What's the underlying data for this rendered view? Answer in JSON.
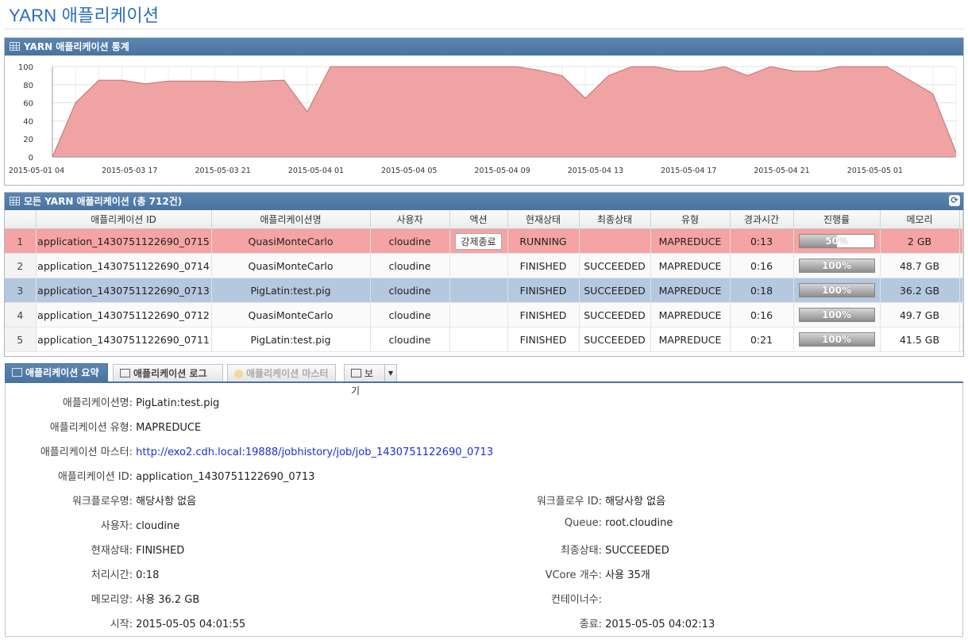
{
  "page": {
    "title": "YARN 애플리케이션"
  },
  "colors": {
    "header": "#4a73a0",
    "area_fill": "#f0a3a3",
    "area_line": "#c07070",
    "running_row": "#f5a3a3",
    "selected_row": "#b4c8df",
    "link": "#1a2fd6"
  },
  "stats_panel": {
    "title": "YARN 애플리케이션 통계"
  },
  "chart_data": {
    "type": "area",
    "title": "",
    "xlabel": "",
    "ylabel": "",
    "ylim": [
      0,
      100
    ],
    "yticks": [
      "0",
      "20",
      "40",
      "60",
      "80",
      "100"
    ],
    "xtick_labels": [
      "2015-05-01 04",
      "2015-05-03 17",
      "2015-05-03 21",
      "2015-05-04 01",
      "2015-05-04 05",
      "2015-05-04 09",
      "2015-05-04 13",
      "2015-05-04 17",
      "2015-05-04 21",
      "2015-05-05 01"
    ],
    "grid": true,
    "values": [
      0,
      60,
      85,
      85,
      81,
      84,
      84,
      84,
      83,
      84,
      85,
      50,
      100,
      100,
      100,
      100,
      100,
      100,
      100,
      100,
      100,
      96,
      90,
      65,
      90,
      100,
      100,
      95,
      95,
      100,
      90,
      100,
      95,
      95,
      100,
      100,
      100,
      85,
      70,
      5
    ]
  },
  "apps_panel": {
    "title": "모든 YARN 애플리케이션 (총 712건)",
    "refresh_icon": "refresh-icon"
  },
  "table": {
    "columns": [
      "애플리케이션 ID",
      "애플리케이션명",
      "사용자",
      "액션",
      "현재상태",
      "최종상태",
      "유형",
      "경과시간",
      "진행률",
      "메모리"
    ],
    "rows": [
      {
        "num": "1",
        "id": "application_1430751122690_0715",
        "name": "QuasiMonteCarlo",
        "user": "cloudine",
        "action": "강제종료",
        "state": "RUNNING",
        "final": "",
        "type": "MAPREDUCE",
        "elapsed": "0:13",
        "progress": 50,
        "progress_label": "50%",
        "memory": "2 GB"
      },
      {
        "num": "2",
        "id": "application_1430751122690_0714",
        "name": "QuasiMonteCarlo",
        "user": "cloudine",
        "action": "",
        "state": "FINISHED",
        "final": "SUCCEEDED",
        "type": "MAPREDUCE",
        "elapsed": "0:16",
        "progress": 100,
        "progress_label": "100%",
        "memory": "48.7 GB"
      },
      {
        "num": "3",
        "id": "application_1430751122690_0713",
        "name": "PigLatin:test.pig",
        "user": "cloudine",
        "action": "",
        "state": "FINISHED",
        "final": "SUCCEEDED",
        "type": "MAPREDUCE",
        "elapsed": "0:18",
        "progress": 100,
        "progress_label": "100%",
        "memory": "36.2 GB"
      },
      {
        "num": "4",
        "id": "application_1430751122690_0712",
        "name": "QuasiMonteCarlo",
        "user": "cloudine",
        "action": "",
        "state": "FINISHED",
        "final": "SUCCEEDED",
        "type": "MAPREDUCE",
        "elapsed": "0:16",
        "progress": 100,
        "progress_label": "100%",
        "memory": "49.7 GB"
      },
      {
        "num": "5",
        "id": "application_1430751122690_0711",
        "name": "PigLatin:test.pig",
        "user": "cloudine",
        "action": "",
        "state": "FINISHED",
        "final": "SUCCEEDED",
        "type": "MAPREDUCE",
        "elapsed": "0:21",
        "progress": 100,
        "progress_label": "100%",
        "memory": "41.5 GB"
      }
    ]
  },
  "tabs": {
    "summary": "애플리케이션 요약",
    "log": "애플리케이션 로그",
    "master": "애플리케이션 마스터",
    "view": "보기"
  },
  "details": {
    "app_name": {
      "label": "애플리케이션명:",
      "value": "PigLatin:test.pig"
    },
    "app_type": {
      "label": "애플리케이션 유형:",
      "value": "MAPREDUCE"
    },
    "app_master": {
      "label": "애플리케이션 마스터:",
      "value": "http://exo2.cdh.local:19888/jobhistory/job/job_1430751122690_0713"
    },
    "app_id": {
      "label": "애플리케이션 ID:",
      "value": "application_1430751122690_0713"
    },
    "workflow_name": {
      "label": "워크플로우명:",
      "value": "해당사항 없음"
    },
    "workflow_id": {
      "label": "워크플로우 ID:",
      "value": "해당사항 없음"
    },
    "user": {
      "label": "사용자:",
      "value": "cloudine"
    },
    "queue": {
      "label": "Queue:",
      "value": "root.cloudine"
    },
    "state": {
      "label": "현재상태:",
      "value": "FINISHED"
    },
    "final_state": {
      "label": "최종상태:",
      "value": "SUCCEEDED"
    },
    "proc_time": {
      "label": "처리시간:",
      "value": "0:18"
    },
    "vcores": {
      "label": "VCore 개수:",
      "value": "사용 35개"
    },
    "memory": {
      "label": "메모리양:",
      "value": "사용 36.2 GB"
    },
    "containers": {
      "label": "컨테이너수:",
      "value": ""
    },
    "start": {
      "label": "시작:",
      "value": "2015-05-05 04:01:55"
    },
    "end": {
      "label": "종료:",
      "value": "2015-05-05 04:02:13"
    }
  }
}
